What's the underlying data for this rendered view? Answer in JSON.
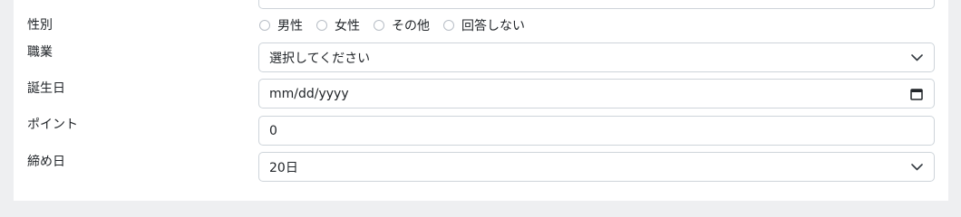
{
  "form": {
    "gender": {
      "label": "性別",
      "options": [
        "男性",
        "女性",
        "その他",
        "回答しない"
      ]
    },
    "occupation": {
      "label": "職業",
      "value": "選択してください"
    },
    "birthday": {
      "label": "誕生日",
      "value": "mm/dd/yyyy"
    },
    "points": {
      "label": "ポイント",
      "value": "0"
    },
    "closing_day": {
      "label": "締め日",
      "value": "20日"
    }
  },
  "icons": {
    "select": "chevron-down-icon",
    "date": "calendar-icon"
  }
}
